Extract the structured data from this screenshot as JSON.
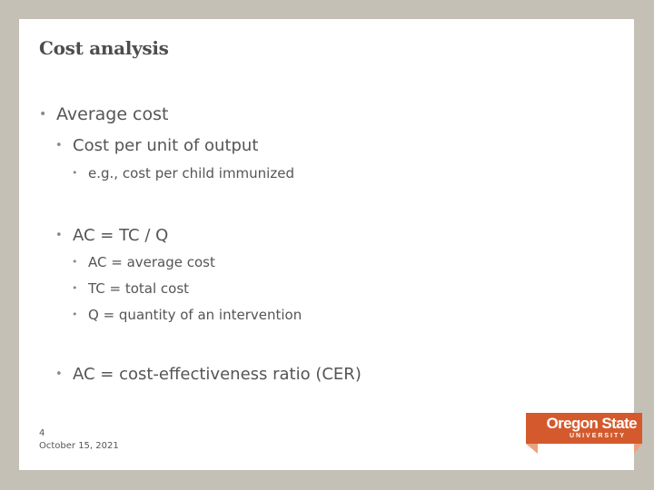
{
  "slide": {
    "title": "Cost analysis",
    "bullets": {
      "b1": "Average cost",
      "b1_1": "Cost per unit of output",
      "b1_1_1": "e.g., cost per child immunized",
      "b2": "AC = TC / Q",
      "b2_1": "AC = average cost",
      "b2_2": "TC = total cost",
      "b2_3": "Q = quantity of an intervention",
      "b3": "AC = cost-effectiveness ratio (CER)"
    },
    "bullet_glyph": "•",
    "footer": {
      "page_number": "4",
      "date": "October 15, 2021"
    },
    "logo": {
      "name": "Oregon State",
      "sub": "UNIVERSITY",
      "brand_color": "#d45a2d",
      "accent_color": "#eba27f"
    }
  }
}
